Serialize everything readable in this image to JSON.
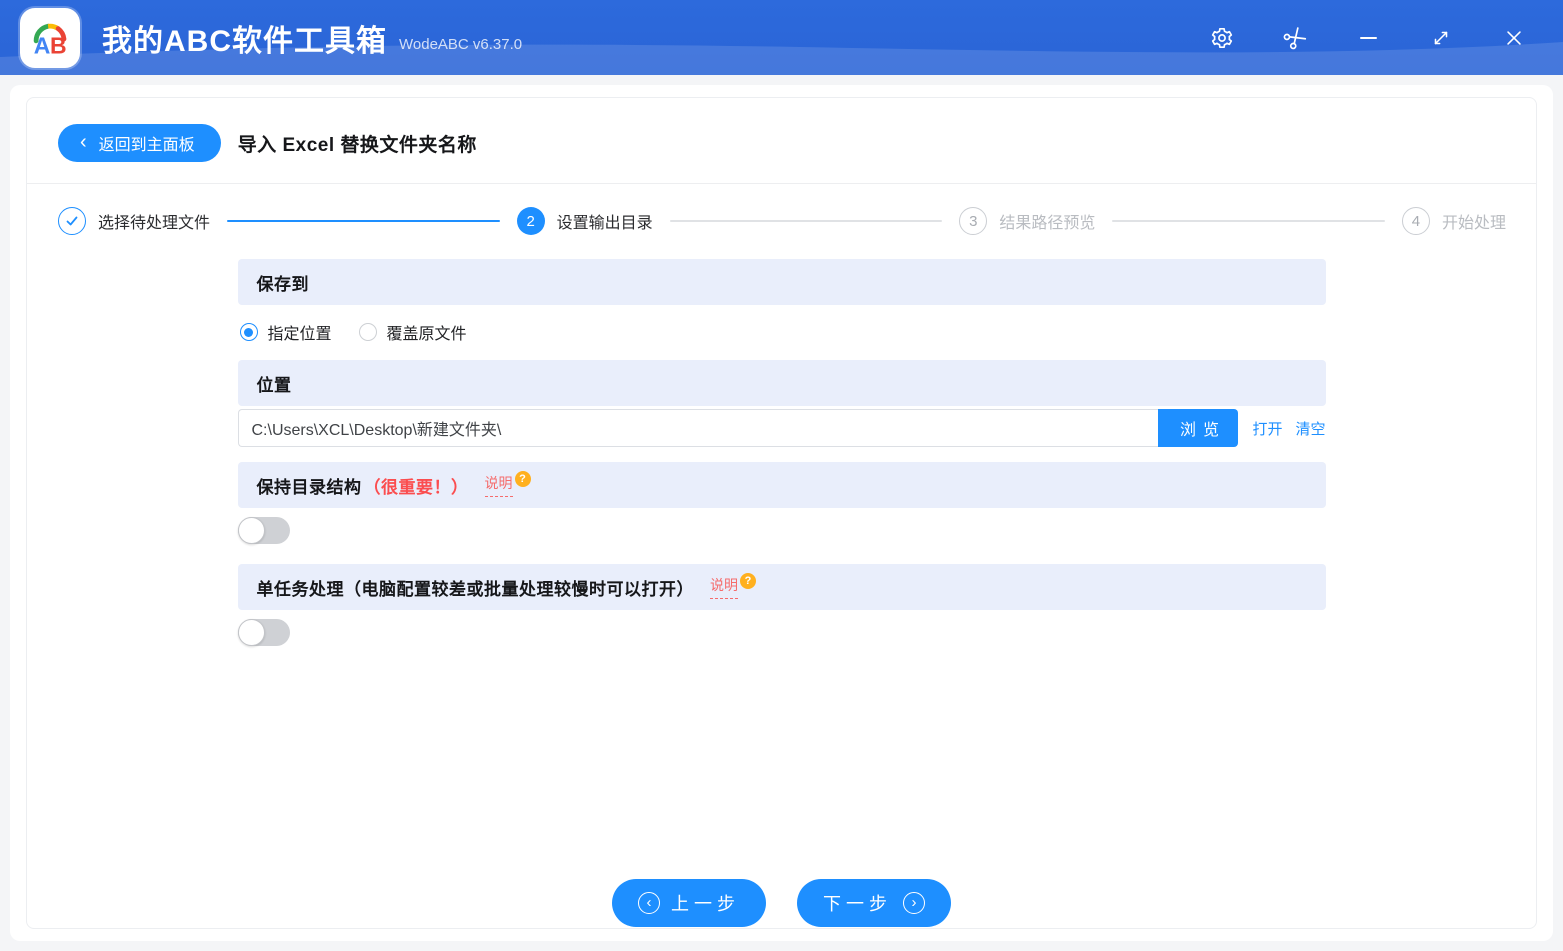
{
  "titlebar": {
    "logo_text": "AB",
    "title": "我的ABC软件工具箱",
    "version": "WodeABC v6.37.0",
    "icons": [
      "settings",
      "scissors",
      "minimize",
      "maximize",
      "close"
    ]
  },
  "header": {
    "back_label": "返回到主面板",
    "page_title": "导入 Excel 替换文件夹名称"
  },
  "steps": [
    {
      "label": "选择待处理文件",
      "state": "done"
    },
    {
      "number": "2",
      "label": "设置输出目录",
      "state": "active"
    },
    {
      "number": "3",
      "label": "结果路径预览",
      "state": "pending"
    },
    {
      "number": "4",
      "label": "开始处理",
      "state": "pending"
    }
  ],
  "save_to": {
    "title": "保存到",
    "option_specified": "指定位置",
    "option_overwrite": "覆盖原文件",
    "selected": "指定位置"
  },
  "location": {
    "title": "位置",
    "path": "C:\\Users\\XCL\\Desktop\\新建文件夹\\",
    "browse_label": "浏览",
    "open_label": "打开",
    "clear_label": "清空"
  },
  "keep_structure": {
    "title": "保持目录结构",
    "warning": "（很重要！）",
    "help_label": "说明",
    "help_badge": "?",
    "enabled": false
  },
  "single_task": {
    "title": "单任务处理（电脑配置较差或批量处理较慢时可以打开）",
    "help_label": "说明",
    "help_badge": "?",
    "enabled": false
  },
  "footer": {
    "prev_label": "上一步",
    "next_label": "下一步"
  },
  "colors": {
    "accent": "#1e8fff",
    "titlebar_blue": "#2b67da",
    "section_bg": "#e9eefb",
    "warning_red": "#fb4d4f",
    "help_red": "#f56c6c",
    "badge_orange": "#ffb01f"
  }
}
